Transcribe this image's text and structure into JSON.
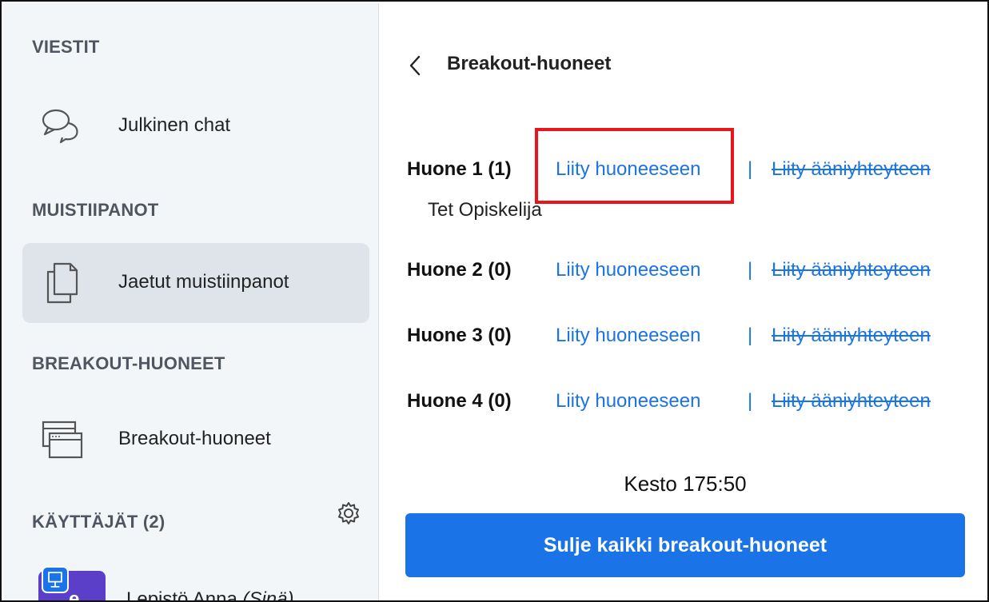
{
  "sidebar": {
    "sections": {
      "messages": "VIESTIT",
      "notes": "MUISTIIPANOT",
      "breakouts": "BREAKOUT-HUONEET",
      "users": "KÄYTTÄJÄT (2)"
    },
    "items": [
      {
        "label": "Julkinen chat",
        "icon": "chat-bubbles-icon"
      },
      {
        "label": "Jaetut muistiinpanot",
        "icon": "documents-icon"
      },
      {
        "label": "Breakout-huoneet",
        "icon": "windows-icon"
      }
    ],
    "user": {
      "avatar_letter": "e",
      "name": "Lepistö Anna",
      "self_tag": "(Sinä)"
    }
  },
  "main": {
    "title": "Breakout-huoneet",
    "rooms": [
      {
        "name": "Huone 1 (1)",
        "join": "Liity huoneeseen",
        "sep": "|",
        "audio": "Liity ääniyhteyteen",
        "members": [
          "Tet Opiskelija"
        ]
      },
      {
        "name": "Huone 2 (0)",
        "join": "Liity huoneeseen",
        "sep": "|",
        "audio": "Liity ääniyhteyteen",
        "members": []
      },
      {
        "name": "Huone 3 (0)",
        "join": "Liity huoneeseen",
        "sep": "|",
        "audio": "Liity ääniyhteyteen",
        "members": []
      },
      {
        "name": "Huone 4 (0)",
        "join": "Liity huoneeseen",
        "sep": "|",
        "audio": "Liity ääniyhteyteen",
        "members": []
      }
    ],
    "duration": "Kesto 175:50",
    "close_button": "Sulje kaikki breakout-huoneet"
  },
  "colors": {
    "accent": "#1b73e8",
    "highlight": "#e8161b",
    "sidebar_bg": "#f3f6f9",
    "active_item_bg": "#dfe4ea",
    "avatar_bg": "#5b3fc8"
  }
}
